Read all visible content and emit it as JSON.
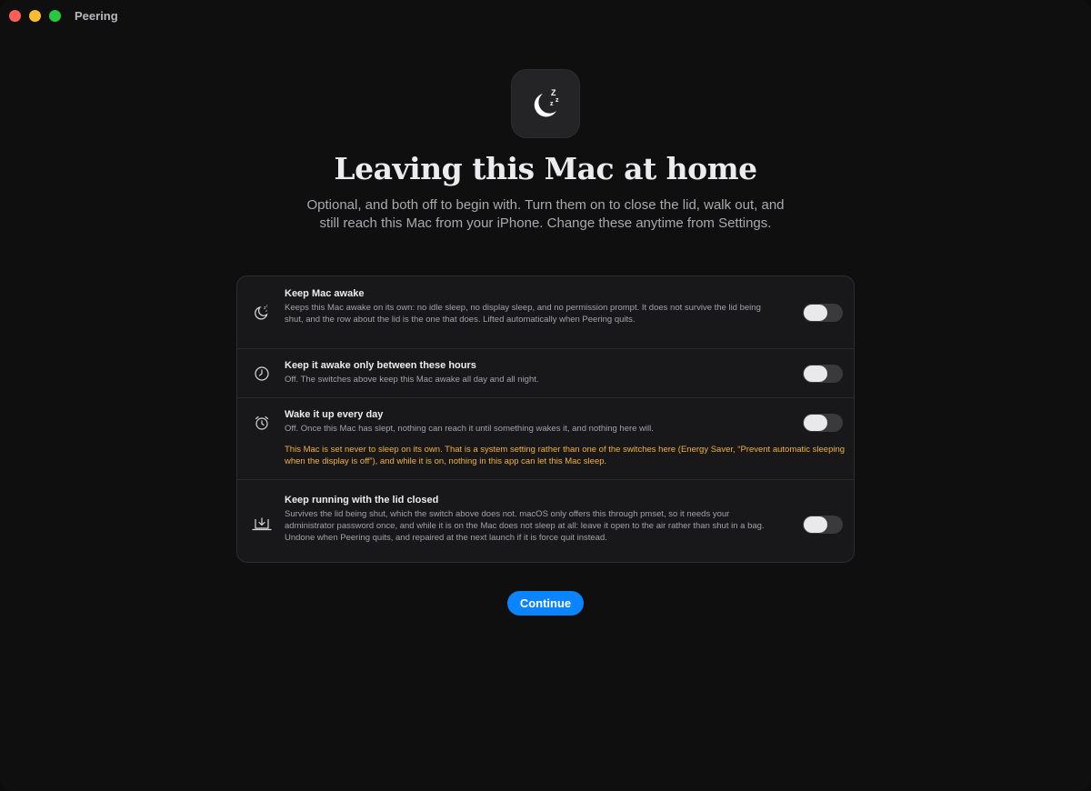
{
  "window": {
    "title": "Peering"
  },
  "header": {
    "headline": "Leaving this Mac at home",
    "subtitle": "Optional, and both off to begin with. Turn them on to close the lid, walk out, and still reach this Mac from your iPhone. Change these anytime from Settings."
  },
  "settings": [
    {
      "icon": "moon-zzz-icon",
      "title": "Keep Mac awake",
      "description": "Keeps this Mac awake on its own: no idle sleep, no display sleep, and no permission prompt. It does not survive the lid being shut, and the row about the lid is the one that does. Lifted automatically when Peering quits.",
      "enabled": false
    },
    {
      "icon": "clock-icon",
      "title": "Keep it awake only between these hours",
      "description": "Off. The switches above keep this Mac awake all day and all night.",
      "enabled": false
    },
    {
      "icon": "alarm-clock-icon",
      "title": "Wake it up every day",
      "description": "Off. Once this Mac has slept, nothing can reach it until something wakes it, and nothing here will.",
      "warning": "This Mac is set never to sleep on its own. That is a system setting rather than one of the switches here (Energy Saver, “Prevent automatic sleeping when the display is off”), and while it is on, nothing in this app can let this Mac sleep.",
      "enabled": false
    },
    {
      "icon": "laptop-lid-icon",
      "title": "Keep running with the lid closed",
      "description": "Survives the lid being shut, which the switch above does not. macOS only offers this through pmset, so it needs your administrator password once, and while it is on the Mac does not sleep at all: leave it open to the air rather than shut in a bag. Undone when Peering quits, and repaired at the next launch if it is force quit instead.",
      "enabled": false
    }
  ],
  "actions": {
    "continue_label": "Continue"
  },
  "colors": {
    "accent": "#0a84ff",
    "warning": "#f2b13a"
  }
}
